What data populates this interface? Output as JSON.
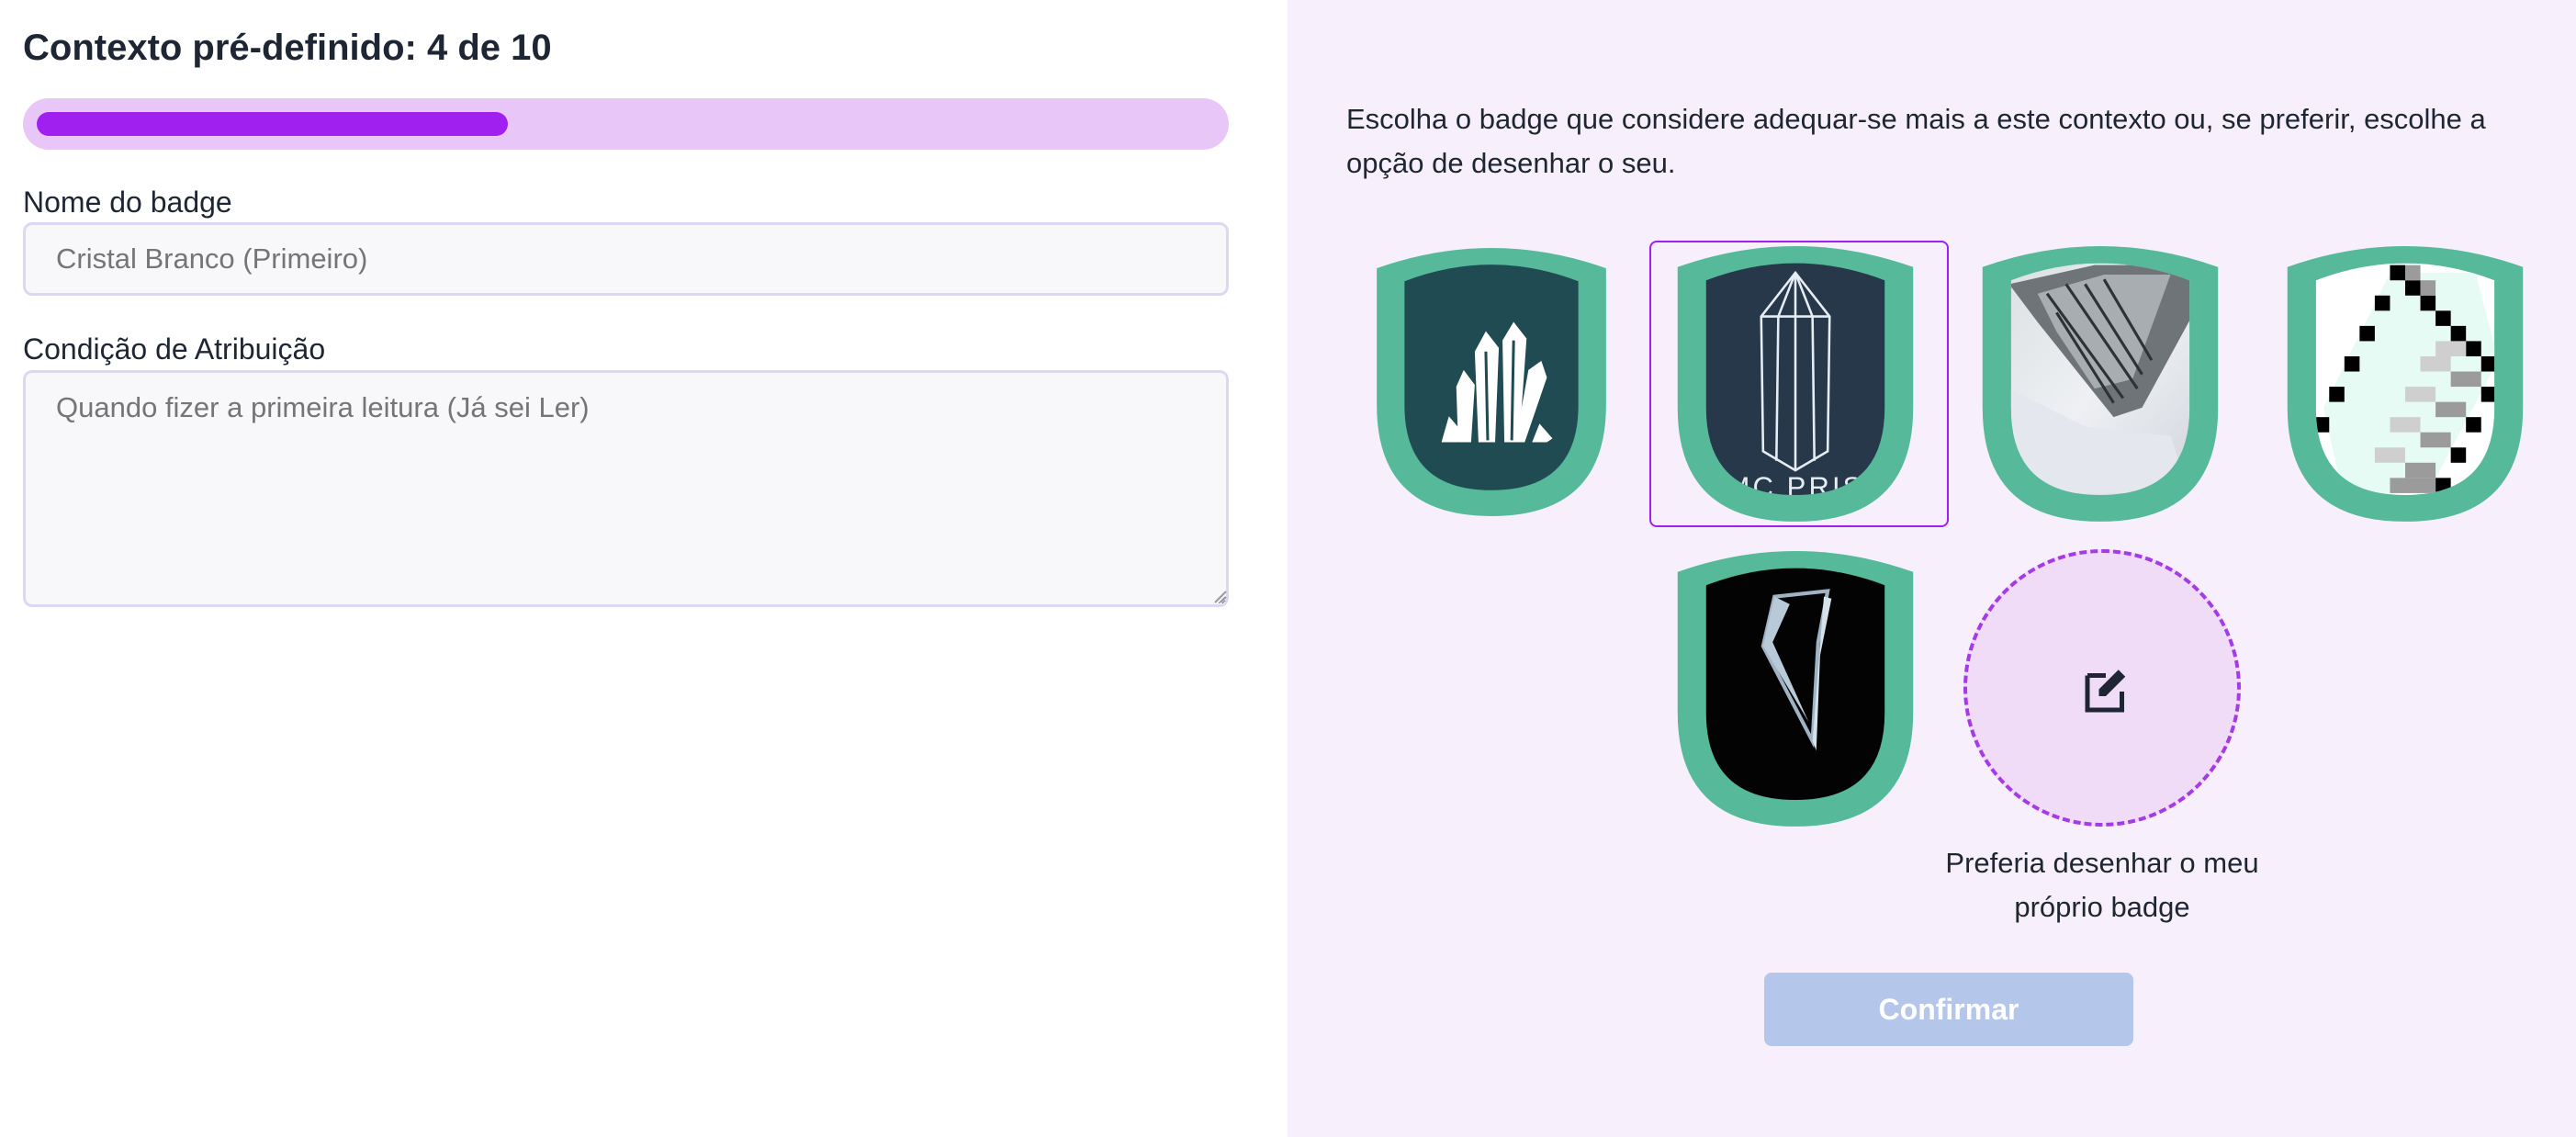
{
  "header": {
    "title": "Contexto pré-definido: 4 de 10"
  },
  "progress": {
    "current": 4,
    "total": 10,
    "fraction": 0.4
  },
  "form": {
    "name_label": "Nome do badge",
    "name_placeholder": "Cristal Branco (Primeiro)",
    "condition_label": "Condição de Atribuição",
    "condition_placeholder": "Quando fizer a primeira leitura (Já sei Ler)"
  },
  "badge_picker": {
    "instructions": "Escolha o badge que considere adequar-se mais a este contexto ou, se preferir, escolhe a opção de desenhar o seu.",
    "selected_index": 1,
    "badges": [
      {
        "name": "crystal-cluster-badge"
      },
      {
        "name": "prism-crystal-badge",
        "caption": "MC PRIS"
      },
      {
        "name": "crystal-photo-badge"
      },
      {
        "name": "pixel-crystal-badge"
      },
      {
        "name": "dark-shard-badge"
      }
    ],
    "draw_option_caption": "Preferia desenhar o meu próprio badge",
    "confirm_label": "Confirmar"
  },
  "colors": {
    "accent": "#a020f0",
    "progress_track": "#e8c6f8",
    "badge_rim": "#56b99a",
    "right_panel_bg": "#f7f0fc",
    "confirm_disabled": "#b4c6ea"
  }
}
